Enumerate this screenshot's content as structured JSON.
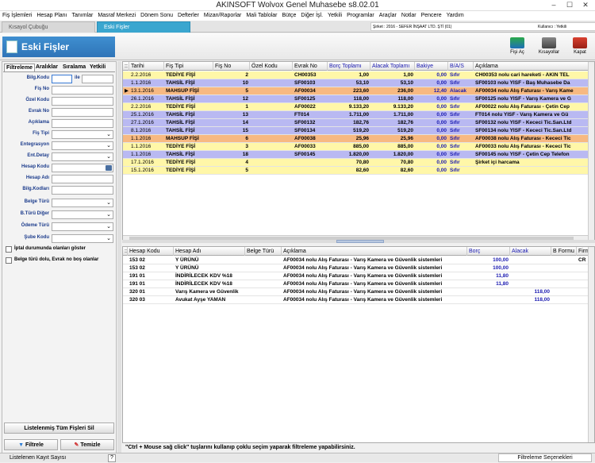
{
  "app": {
    "title": "AKINSOFT Wolvox Genel Muhasebe s8.02.01",
    "minimize": "–",
    "maximize": "☐",
    "close": "✕"
  },
  "menu": [
    "Fiş İşlemleri",
    "Hesap Planı",
    "Tanımlar",
    "Masraf Merkezi",
    "Dönem Sonu",
    "Defterler",
    "Mizan/Raporlar",
    "Mali Tablolar",
    "Bütçe",
    "Diğer İşl.",
    "Yetkili",
    "Programlar",
    "Araçlar",
    "Notlar",
    "Pencere",
    "Yardım"
  ],
  "tabs": {
    "shortcut": "Kısayol Çubuğu",
    "current": "Eski Fişler"
  },
  "company": {
    "label": "Şirket : 2016 - SEFER İNŞAAT LTD. ŞTİ (01)",
    "user": "Kullanıcı : Yetkili"
  },
  "page_title": "Eski Fişler",
  "toolbar": {
    "fis_ac": "Fişi Aç",
    "kisayollar": "Kısayollar",
    "kapat": "Kapat"
  },
  "left": {
    "tabs": [
      "Filtreleme",
      "Aralıklar",
      "Sıralama",
      "Yetkili"
    ],
    "fields": [
      "Bilg.Kodu",
      "Fiş No",
      "Özel Kodu",
      "Evrak No",
      "Açıklama",
      "Fiş Tipi",
      "Entegrasyon",
      "Ent.Detay",
      "Hesap Kodu",
      "Hesap Adı",
      "Bilg.Kodları",
      "Belge Türü",
      "B.Türü Diğer",
      "Ödeme Türü",
      "Şube Kodu"
    ],
    "ile": "ile",
    "check1": "İptal durumunda olanları göster",
    "check2": "Belge türü dolu, Evrak no boş olanlar",
    "list_clear": "Listelenmiş Tüm Fişleri Sil",
    "filter": "Filtrele",
    "clean": "Temizle"
  },
  "top_grid": {
    "headers": [
      "::",
      "Tarihi",
      "Fiş Tipi",
      "Fiş No",
      "Özel Kodu",
      "Evrak No",
      "Borç Toplamı",
      "Alacak Toplamı",
      "Bakiye",
      "B/A/S",
      "Açıklama"
    ],
    "rows": [
      [
        "",
        "2.2.2016",
        "TEDİYE FİŞİ",
        "2",
        "",
        "CH00353",
        "1,00",
        "1,00",
        "0,00",
        "Sıfır",
        "CH00353 nolu cari hareketi - AKIN TEL"
      ],
      [
        "",
        "1.1.2016",
        "TAHSİL FİŞİ",
        "10",
        "",
        "SF00103",
        "53,10",
        "53,10",
        "0,00",
        "Sıfır",
        "SF00103 nolu YISF - Baş Muhasebe Da"
      ],
      [
        "▶",
        "13.1.2016",
        "MAHSUP FİŞİ",
        "5",
        "",
        "AF00034",
        "223,60",
        "236,00",
        "12,40",
        "Alacak",
        "AF00034 nolu Alış Faturası - Varış Kame"
      ],
      [
        "",
        "26.1.2016",
        "TAHSİL FİŞİ",
        "12",
        "",
        "SF00125",
        "118,00",
        "118,00",
        "0,00",
        "Sıfır",
        "SF00125 nolu YISF - Varış Kamera ve G"
      ],
      [
        "",
        "2.2.2016",
        "TEDİYE FİŞİ",
        "1",
        "",
        "AF00022",
        "9.133,20",
        "9.133,20",
        "0,00",
        "Sıfır",
        "AF00022 nolu Alış Faturası - Çetin Cep"
      ],
      [
        "",
        "25.1.2016",
        "TAHSİL FİŞİ",
        "13",
        "",
        "FT014",
        "1.711,00",
        "1.711,00",
        "0,00",
        "Sıfır",
        "FT014 nolu YISF - Varış Kamera ve Gü"
      ],
      [
        "",
        "27.1.2016",
        "TAHSİL FİŞİ",
        "14",
        "",
        "SF00132",
        "182,76",
        "182,76",
        "0,00",
        "Sıfır",
        "SF00132 nolu YISF - Kececi Tic.San.Ltd"
      ],
      [
        "",
        "8.1.2016",
        "TAHSİL FİŞİ",
        "15",
        "",
        "SF00134",
        "519,20",
        "519,20",
        "0,00",
        "Sıfır",
        "SF00134 nolu YISF - Kececi Tic.San.Ltd"
      ],
      [
        "",
        "1.1.2016",
        "MAHSUP FİŞİ",
        "6",
        "",
        "AF00038",
        "25,96",
        "25,96",
        "0,00",
        "Sıfır",
        "AF00038 nolu Alış Faturası - Kececi Tic"
      ],
      [
        "",
        "1.1.2016",
        "TEDİYE FİŞİ",
        "3",
        "",
        "AF00033",
        "885,00",
        "885,00",
        "0,00",
        "Sıfır",
        "AF00033 nolu Alış Faturası - Kececi Tic"
      ],
      [
        "",
        "1.1.2016",
        "TAHSİL FİŞİ",
        "18",
        "",
        "SF00145",
        "1.820,00",
        "1.820,00",
        "0,00",
        "Sıfır",
        "SF00145 nolu YISF - Çetin Cep Telefon"
      ],
      [
        "",
        "17.1.2016",
        "TEDİYE FİŞİ",
        "4",
        "",
        "",
        "70,80",
        "70,80",
        "0,00",
        "Sıfır",
        "Şirket içi harcama"
      ],
      [
        "",
        "15.1.2016",
        "TEDİYE FİŞİ",
        "5",
        "",
        "",
        "82,60",
        "82,60",
        "0,00",
        "Sıfır",
        ""
      ]
    ],
    "row_colors": [
      "#fff7a8",
      "#b9b9f2",
      "#f7b982",
      "#b9b9f2",
      "#fff7a8",
      "#b9b9f2",
      "#b9b9f2",
      "#b9b9f2",
      "#f7b982",
      "#fff7a8",
      "#b9b9f2",
      "#fff7a8",
      "#fff7a8"
    ]
  },
  "bottom_grid": {
    "headers": [
      "::",
      "Hesap Kodu",
      "Hesap Adı",
      "Belge Türü",
      "Açıklama",
      "Borç",
      "Alacak",
      "B Formu",
      "Firma"
    ],
    "rows": [
      [
        "",
        "153 02",
        "Y ÜRÜNÜ",
        "",
        "AF00034 nolu Alış Faturası - Varış Kamera ve Güvenlik sistemleri",
        "100,00",
        "",
        "",
        "CR"
      ],
      [
        "",
        "153 02",
        "Y ÜRÜNÜ",
        "",
        "AF00034 nolu Alış Faturası - Varış Kamera ve Güvenlik sistemleri",
        "100,00",
        "",
        "",
        ""
      ],
      [
        "",
        "191 01",
        "İNDİRİLECEK KDV %18",
        "",
        "AF00034 nolu Alış Faturası - Varış Kamera ve Güvenlik sistemleri",
        "11,80",
        "",
        "",
        ""
      ],
      [
        "",
        "191 01",
        "İNDİRİLECEK KDV %18",
        "",
        "AF00034 nolu Alış Faturası - Varış Kamera ve Güvenlik sistemleri",
        "11,80",
        "",
        "",
        ""
      ],
      [
        "",
        "320 01",
        "Varış Kamera ve Güvenlik",
        "",
        "AF00034 nolu Alış Faturası - Varış Kamera ve Güvenlik sistemleri",
        "",
        "118,00",
        "",
        ""
      ],
      [
        "",
        "320 03",
        "Avukat Ayşe YAMAN",
        "",
        "AF00034 nolu Alış Faturası - Varış Kamera ve Güvenlik sistemleri",
        "",
        "118,00",
        "",
        ""
      ]
    ]
  },
  "hint": "\"Ctrl + Mouse sağ click\" tuşlarını kullanıp çoklu seçim yaparak filtreleme yapabilirsiniz.",
  "status": {
    "left": "Listelenen Kayıt Sayısı",
    "q": "?",
    "right": "Filtreleme Seçenekleri"
  }
}
